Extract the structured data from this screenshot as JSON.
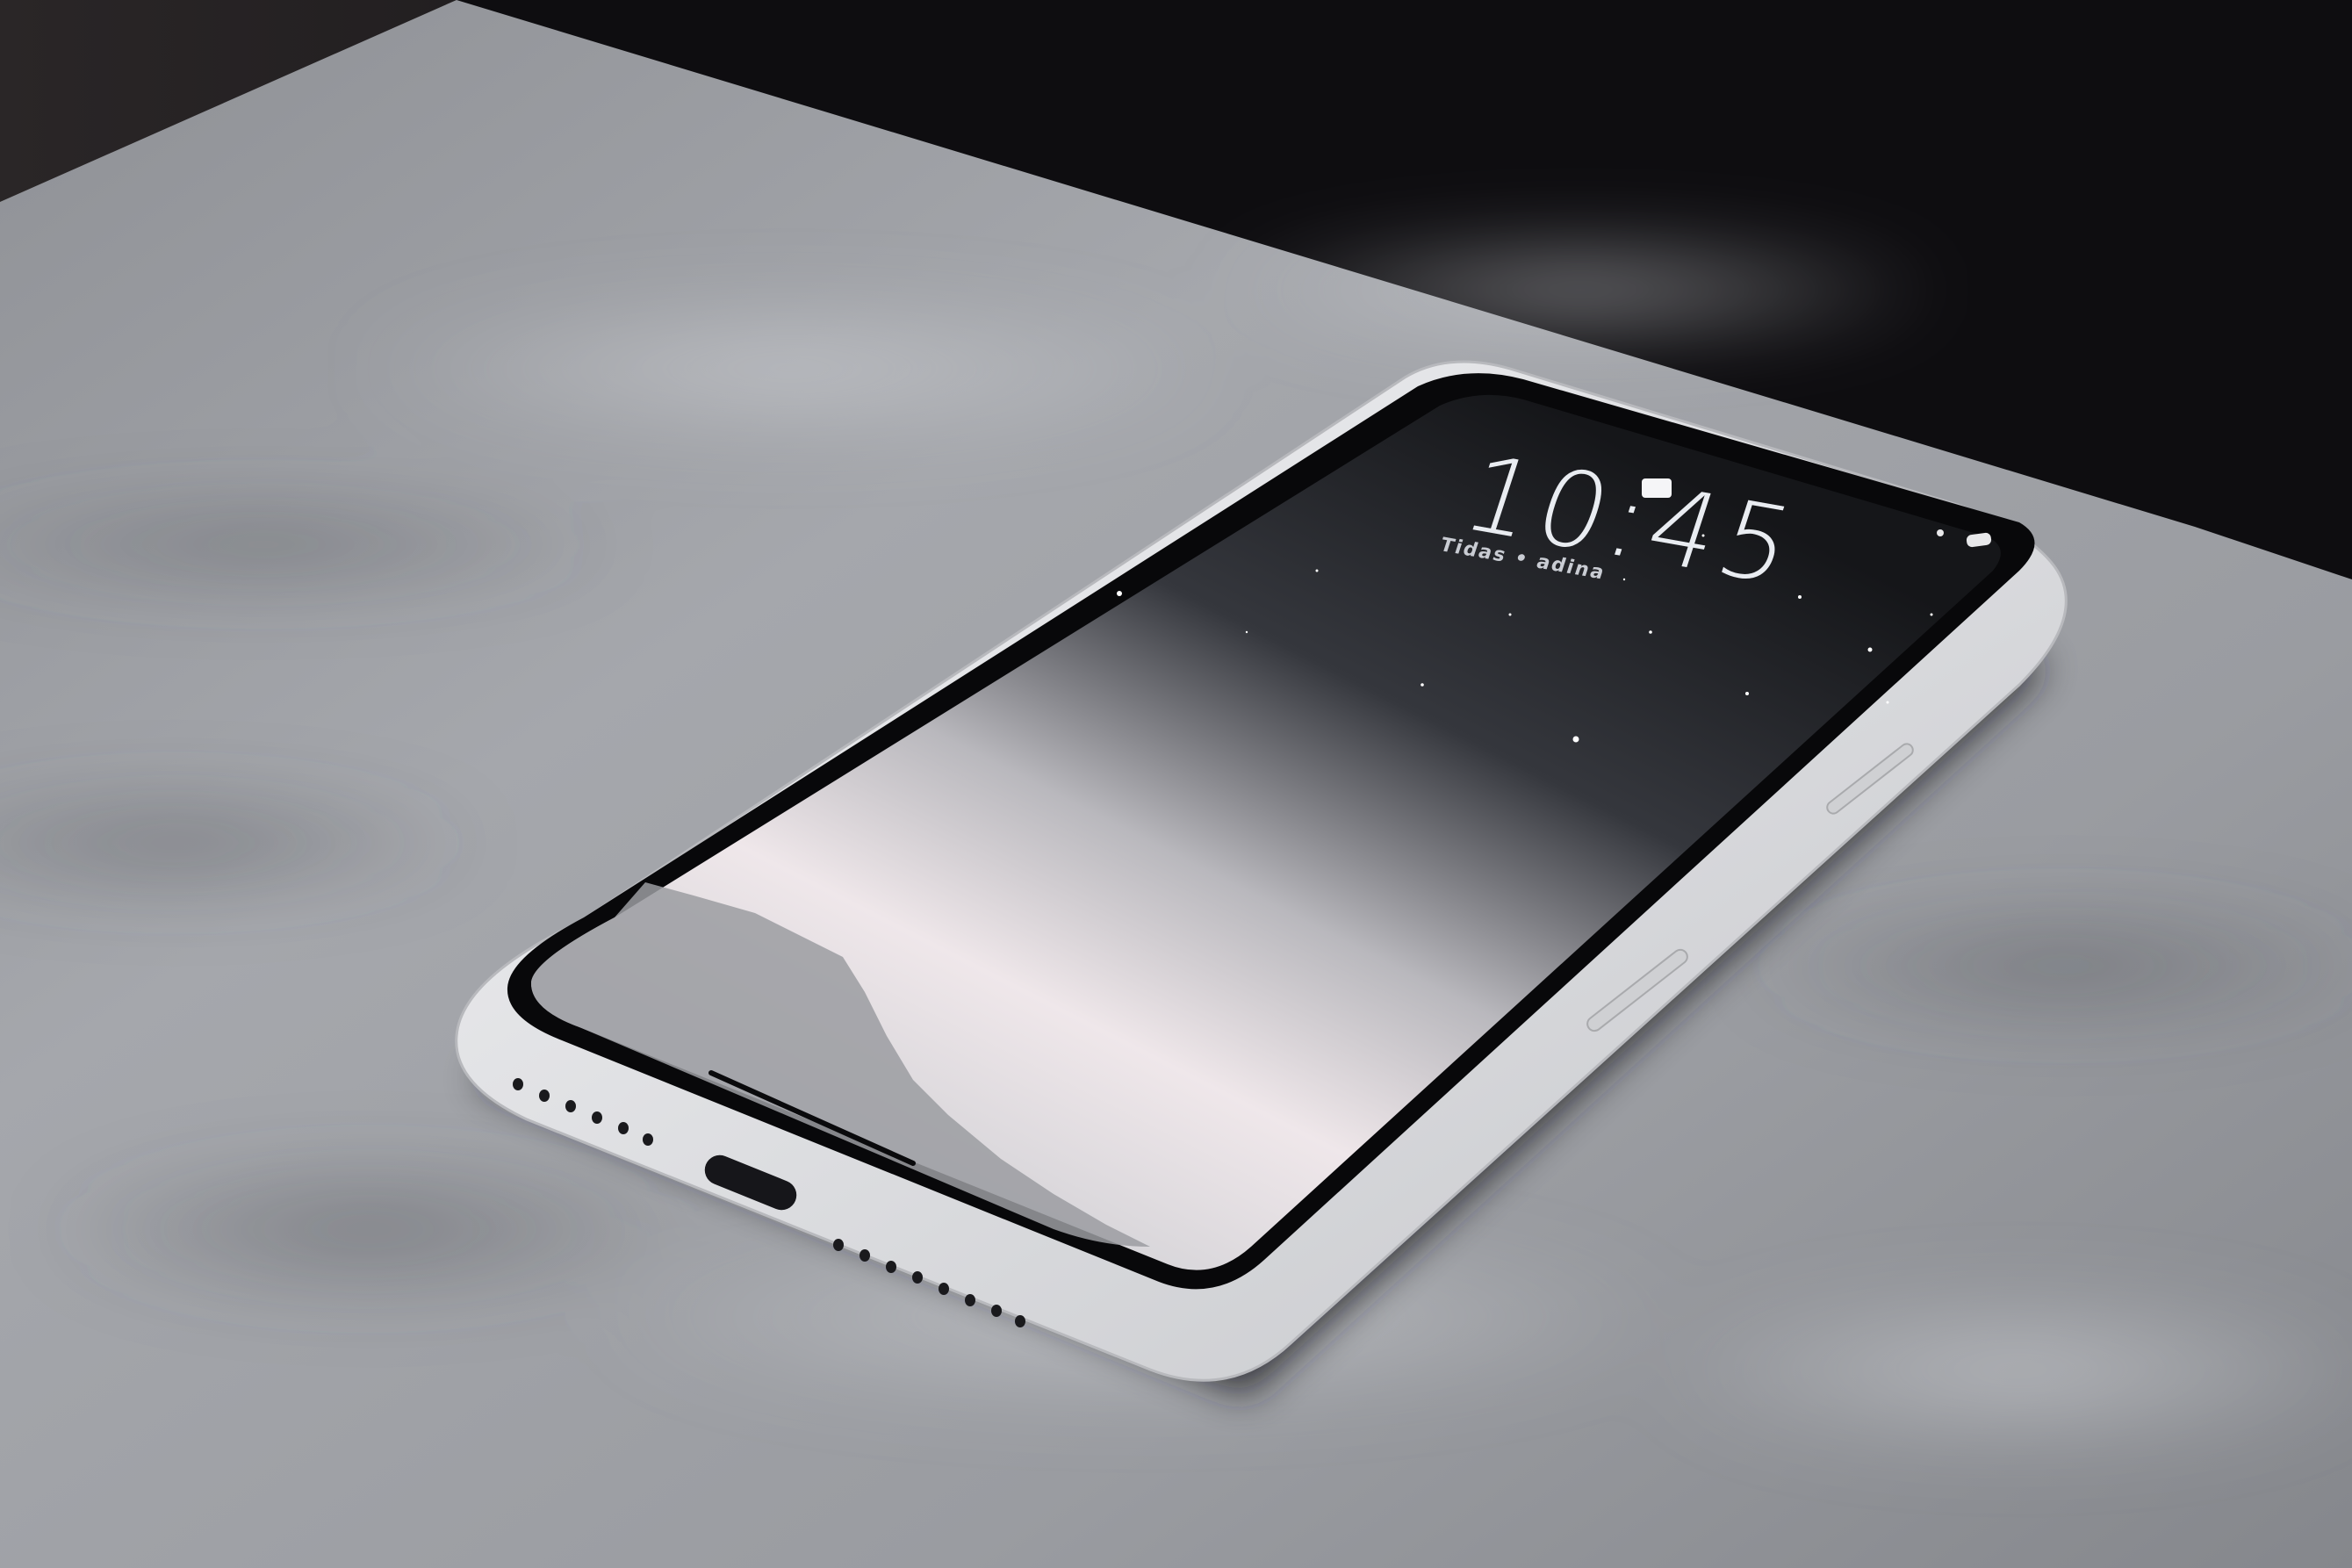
{
  "lock_screen": {
    "time": "10:45",
    "date_line": "Tidas • adina"
  }
}
